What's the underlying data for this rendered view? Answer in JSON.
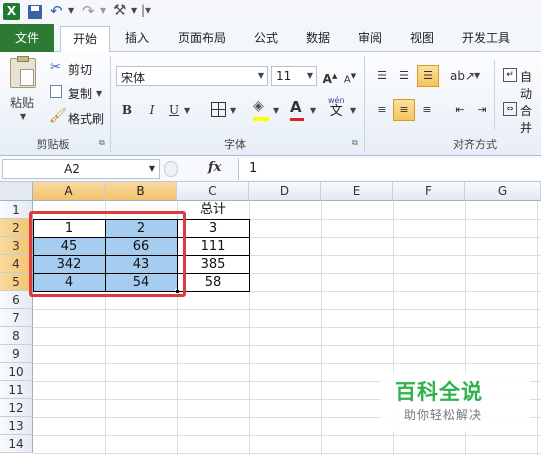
{
  "qat": {
    "excel_icon": "excel-logo-icon",
    "save_icon": "save-icon",
    "undo_icon": "undo-icon",
    "redo_icon": "redo-icon",
    "customize_icon": "customize-icon"
  },
  "tabs": [
    {
      "label": "文件",
      "active": false,
      "file": true
    },
    {
      "label": "开始",
      "active": true
    },
    {
      "label": "插入"
    },
    {
      "label": "页面布局"
    },
    {
      "label": "公式"
    },
    {
      "label": "数据"
    },
    {
      "label": "审阅"
    },
    {
      "label": "视图"
    },
    {
      "label": "开发工具"
    }
  ],
  "ribbon": {
    "clipboard": {
      "paste": "粘贴",
      "cut": "剪切",
      "copy": "复制",
      "format_painter": "格式刷",
      "group": "剪贴板"
    },
    "font": {
      "name": "宋体",
      "size": "11",
      "bold": "B",
      "italic": "I",
      "underline": "U",
      "phonetic": "wén",
      "phonetic_char": "文",
      "group": "字体"
    },
    "alignment": {
      "group": "对齐方式",
      "auto_wrap": "自动",
      "merge": "合并"
    }
  },
  "formula_bar": {
    "name_box": "A2",
    "fx": "fx",
    "content": "1"
  },
  "columns": [
    "A",
    "B",
    "C",
    "D",
    "E",
    "F",
    "G"
  ],
  "rows": [
    "1",
    "2",
    "3",
    "4",
    "5",
    "6",
    "7",
    "8",
    "9",
    "10",
    "11",
    "12",
    "13",
    "14"
  ],
  "sheet": {
    "header_c": "总计",
    "data": [
      [
        "1",
        "2",
        "3"
      ],
      [
        "45",
        "66",
        "111"
      ],
      [
        "342",
        "43",
        "385"
      ],
      [
        "4",
        "54",
        "58"
      ]
    ]
  },
  "watermark": {
    "title": "百科全说",
    "subtitle": "助你轻松解决"
  },
  "colors": {
    "file_tab": "#2c7a34",
    "selection_fill": "#a6cdf0",
    "highlight_border": "#e0393e",
    "watermark": "#2db34a"
  }
}
